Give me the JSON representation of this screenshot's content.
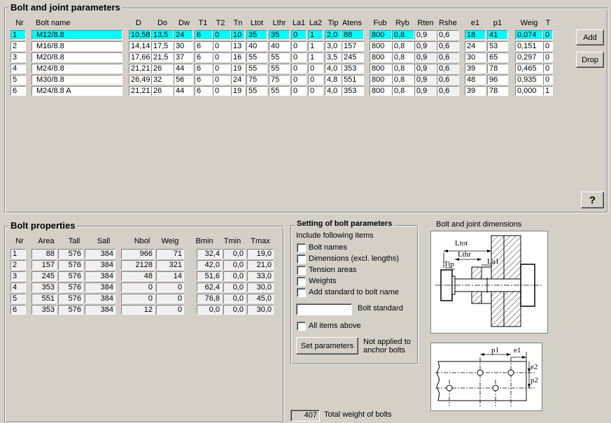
{
  "joint_group": {
    "title": "Bolt and joint parameters",
    "headers": [
      "Nr",
      "Bolt name",
      "D",
      "Do",
      "Dw",
      "T1",
      "T2",
      "Tn",
      "Ltot",
      "Lthr",
      "La1",
      "La2",
      "Tip",
      "Atens",
      "Fub",
      "Ryb",
      "Rten",
      "Rshe",
      "e1",
      "p1",
      "Weig",
      "T"
    ],
    "rows": [
      [
        "1",
        "M12/8.8",
        "10,58",
        "13,5",
        "24",
        "6",
        "0",
        "10",
        "35",
        "35",
        "0",
        "1",
        "2,0",
        "88",
        "800",
        "0,8",
        "0,9",
        "0,6",
        "18",
        "41",
        "0,074",
        "0"
      ],
      [
        "2",
        "M16/8.8",
        "14,14",
        "17,5",
        "30",
        "6",
        "0",
        "13",
        "40",
        "40",
        "0",
        "1",
        "3,0",
        "157",
        "800",
        "0,8",
        "0,9",
        "0,6",
        "24",
        "53",
        "0,151",
        "0"
      ],
      [
        "3",
        "M20/8.8",
        "17,66",
        "21,5",
        "37",
        "6",
        "0",
        "16",
        "55",
        "55",
        "0",
        "1",
        "3,5",
        "245",
        "800",
        "0,8",
        "0,9",
        "0,6",
        "30",
        "65",
        "0,297",
        "0"
      ],
      [
        "4",
        "M24/8.8",
        "21,21",
        "26",
        "44",
        "6",
        "0",
        "19",
        "55",
        "55",
        "0",
        "0",
        "4,0",
        "353",
        "800",
        "0,8",
        "0,9",
        "0,6",
        "39",
        "78",
        "0,465",
        "0"
      ],
      [
        "5",
        "M30/8.8",
        "26,49",
        "32",
        "56",
        "6",
        "0",
        "24",
        "75",
        "75",
        "0",
        "0",
        "4,8",
        "551",
        "800",
        "0,8",
        "0,9",
        "0,6",
        "48",
        "96",
        "0,935",
        "0"
      ],
      [
        "6",
        "M24/8.8 A",
        "21,21",
        "26",
        "44",
        "6",
        "0",
        "19",
        "55",
        "55",
        "0",
        "0",
        "4,0",
        "353",
        "800",
        "0,8",
        "0,9",
        "0,6",
        "39",
        "78",
        "0,000",
        "1"
      ]
    ],
    "add_label": "Add",
    "drop_label": "Drop",
    "help_label": "?"
  },
  "props_group": {
    "title": "Bolt properties",
    "headers": [
      "Nr",
      "Area",
      "Tall",
      "Sall",
      "Nbol",
      "Weig",
      "Bmin",
      "Tmin",
      "Tmax"
    ],
    "rows": [
      [
        "1",
        "88",
        "576",
        "384",
        "966",
        "71",
        "32,4",
        "0,0",
        "19,0"
      ],
      [
        "2",
        "157",
        "576",
        "384",
        "2128",
        "321",
        "42,0",
        "0,0",
        "21,0"
      ],
      [
        "3",
        "245",
        "576",
        "384",
        "48",
        "14",
        "51,6",
        "0,0",
        "33,0"
      ],
      [
        "4",
        "353",
        "576",
        "384",
        "0",
        "0",
        "62,4",
        "0,0",
        "30,0"
      ],
      [
        "5",
        "551",
        "576",
        "384",
        "0",
        "0",
        "76,8",
        "0,0",
        "45,0"
      ],
      [
        "6",
        "353",
        "576",
        "384",
        "12",
        "0",
        "0,0",
        "0,0",
        "30,0"
      ]
    ]
  },
  "settings": {
    "title": "Setting of bolt parameters",
    "subtitle": "Include following items",
    "options": [
      "Bolt names",
      "Dimensions (excl. lengths)",
      "Tension areas",
      "Weights",
      "Add standard to bolt name"
    ],
    "standard_value": "",
    "standard_label": "Bolt standard",
    "all_items_label": "All items above",
    "set_button": "Set parameters",
    "note": "Not applied to anchor bolts"
  },
  "diagram": {
    "title": "Bolt and joint dimensions",
    "labels": {
      "ltot": "Ltot",
      "lthr": "Lthr",
      "tip": "Tip",
      "la1": "La1",
      "p1": "p1",
      "e1": "e1",
      "e2": "e2",
      "p2": "p2"
    }
  },
  "total": {
    "value": "407",
    "label": "Total weight of bolts"
  }
}
